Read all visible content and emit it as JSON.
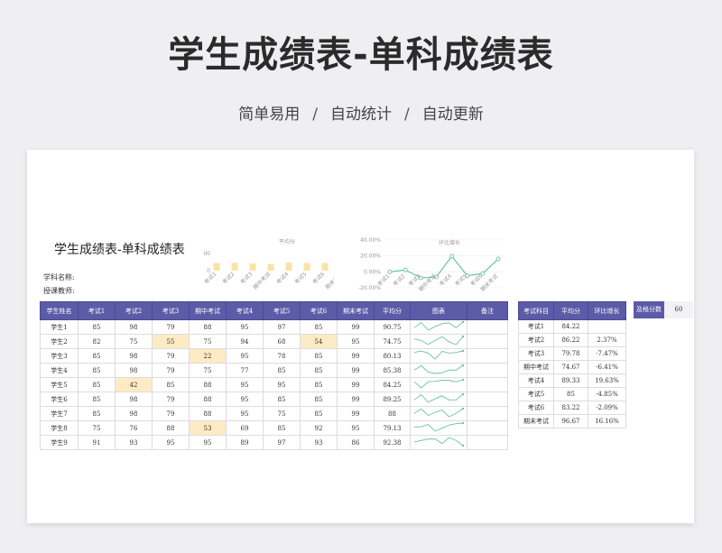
{
  "header": {
    "title": "学生成绩表-单科成绩表",
    "subtitle_parts": [
      "简单易用",
      "自动统计",
      "自动更新"
    ],
    "separator": "/"
  },
  "sheet": {
    "title": "学生成绩表-单科成绩表",
    "subject_label": "学科名称:",
    "teacher_label": "授课教师:",
    "pass_label": "及格分数",
    "pass_value": "60"
  },
  "main_table": {
    "headers": [
      "学生姓名",
      "考试1",
      "考试2",
      "考试3",
      "期中考试",
      "考试4",
      "考试5",
      "考试6",
      "期末考试",
      "平均分",
      "图表",
      "备注"
    ],
    "rows": [
      {
        "name": "学生1",
        "scores": [
          85,
          98,
          79,
          88,
          95,
          97,
          85,
          99
        ],
        "avg": "90.75",
        "hl": []
      },
      {
        "name": "学生2",
        "scores": [
          82,
          75,
          55,
          75,
          94,
          68,
          54,
          95
        ],
        "avg": "74.75",
        "hl": [
          2,
          6
        ]
      },
      {
        "name": "学生3",
        "scores": [
          85,
          98,
          79,
          22,
          95,
          78,
          85,
          99
        ],
        "avg": "80.13",
        "hl": [
          3
        ]
      },
      {
        "name": "学生4",
        "scores": [
          85,
          98,
          79,
          75,
          77,
          85,
          85,
          99
        ],
        "avg": "85.38",
        "hl": []
      },
      {
        "name": "学生5",
        "scores": [
          85,
          42,
          85,
          88,
          95,
          95,
          85,
          99
        ],
        "avg": "84.25",
        "hl": [
          1
        ]
      },
      {
        "name": "学生6",
        "scores": [
          85,
          98,
          79,
          88,
          95,
          85,
          85,
          99
        ],
        "avg": "89.25",
        "hl": []
      },
      {
        "name": "学生7",
        "scores": [
          85,
          98,
          79,
          88,
          95,
          75,
          85,
          99
        ],
        "avg": "88",
        "hl": []
      },
      {
        "name": "学生8",
        "scores": [
          75,
          76,
          88,
          53,
          69,
          85,
          92,
          95
        ],
        "avg": "79.13",
        "hl": [
          3
        ]
      },
      {
        "name": "学生9",
        "scores": [
          91,
          93,
          95,
          95,
          89,
          97,
          93,
          86
        ],
        "avg": "92.38",
        "hl": []
      }
    ]
  },
  "summary_table": {
    "headers": [
      "考试科目",
      "平均分",
      "环比增长"
    ],
    "rows": [
      [
        "考试1",
        "84.22",
        ""
      ],
      [
        "考试2",
        "86.22",
        "2.37%"
      ],
      [
        "考试3",
        "79.78",
        "-7.47%"
      ],
      [
        "期中考试",
        "74.67",
        "-6.41%"
      ],
      [
        "考试4",
        "89.33",
        "19.63%"
      ],
      [
        "考试5",
        "85",
        "-4.85%"
      ],
      [
        "考试6",
        "83.22",
        "-2.09%"
      ],
      [
        "期末考试",
        "96.67",
        "16.16%"
      ]
    ]
  },
  "chart_data": [
    {
      "type": "bar",
      "title": "平均分",
      "categories": [
        "考试1",
        "考试2",
        "考试3",
        "期中考试",
        "考试4",
        "考试5",
        "考试6",
        "期末考试"
      ],
      "values": [
        84.22,
        86.22,
        79.78,
        74.67,
        89.33,
        85,
        83.22,
        96.67
      ],
      "ytick_labels": [
        "00",
        "0"
      ],
      "color": "#fbe3a6"
    },
    {
      "type": "line",
      "title": "环比增长",
      "categories": [
        "考试1",
        "考试2",
        "考试3",
        "期中考试",
        "考试4",
        "考试5",
        "考试6",
        "期末考试"
      ],
      "values": [
        0,
        2.37,
        -7.47,
        -6.41,
        19.63,
        -4.85,
        -2.09,
        16.16
      ],
      "ylim": [
        -20,
        40
      ],
      "ytick_labels": [
        "40.00%",
        "20.00%",
        "0.00%",
        "-20.00%"
      ],
      "color": "#6cc3a0"
    }
  ]
}
